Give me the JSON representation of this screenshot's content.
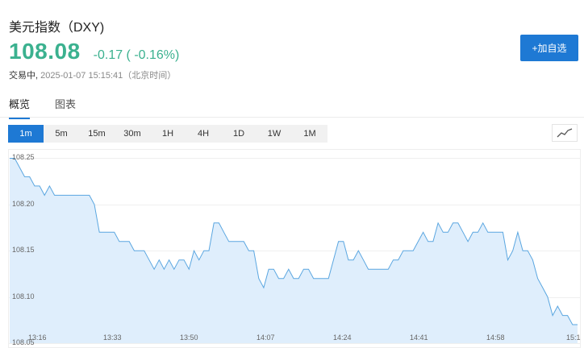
{
  "quote": {
    "name": "美元指数（DXY)",
    "price": "108.08",
    "change": "-0.17 ( -0.16%)",
    "status": "交易中,",
    "time": "2025-01-07 15:15:41（北京时间）",
    "color": "#3bb18f"
  },
  "actions": {
    "add_label": "+加自选"
  },
  "tabs": [
    {
      "label": "概览",
      "active": true
    },
    {
      "label": "图表",
      "active": false
    }
  ],
  "ranges": [
    "1m",
    "5m",
    "15m",
    "30m",
    "1H",
    "4H",
    "1D",
    "1W",
    "1M"
  ],
  "active_range": "1m",
  "icons": {
    "chart_type": "line-chart-icon"
  },
  "colors": {
    "accent": "#1e79d4",
    "line": "#5aa6e0",
    "fill": "#dfeefc",
    "up": "#3bb18f"
  },
  "chart_data": {
    "type": "area",
    "x_ticks": [
      "13:16",
      "13:33",
      "13:50",
      "14:07",
      "14:24",
      "14:41",
      "14:58",
      "15:1"
    ],
    "y_ticks": [
      "108.25",
      "108.20",
      "108.15",
      "108.10",
      "108.05"
    ],
    "ylim": [
      108.05,
      108.26
    ],
    "grid": true,
    "values": [
      108.25,
      108.25,
      108.24,
      108.23,
      108.23,
      108.22,
      108.22,
      108.21,
      108.22,
      108.21,
      108.21,
      108.21,
      108.21,
      108.21,
      108.21,
      108.21,
      108.21,
      108.2,
      108.17,
      108.17,
      108.17,
      108.17,
      108.16,
      108.16,
      108.16,
      108.15,
      108.15,
      108.15,
      108.14,
      108.13,
      108.14,
      108.13,
      108.14,
      108.13,
      108.14,
      108.14,
      108.13,
      108.15,
      108.14,
      108.15,
      108.15,
      108.18,
      108.18,
      108.17,
      108.16,
      108.16,
      108.16,
      108.16,
      108.15,
      108.15,
      108.12,
      108.11,
      108.13,
      108.13,
      108.12,
      108.12,
      108.13,
      108.12,
      108.12,
      108.13,
      108.13,
      108.12,
      108.12,
      108.12,
      108.12,
      108.14,
      108.16,
      108.16,
      108.14,
      108.14,
      108.15,
      108.14,
      108.13,
      108.13,
      108.13,
      108.13,
      108.13,
      108.14,
      108.14,
      108.15,
      108.15,
      108.15,
      108.16,
      108.17,
      108.16,
      108.16,
      108.18,
      108.17,
      108.17,
      108.18,
      108.18,
      108.17,
      108.16,
      108.17,
      108.17,
      108.18,
      108.17,
      108.17,
      108.17,
      108.17,
      108.14,
      108.15,
      108.17,
      108.15,
      108.15,
      108.14,
      108.12,
      108.11,
      108.1,
      108.08,
      108.09,
      108.08,
      108.08,
      108.07,
      108.07
    ]
  }
}
